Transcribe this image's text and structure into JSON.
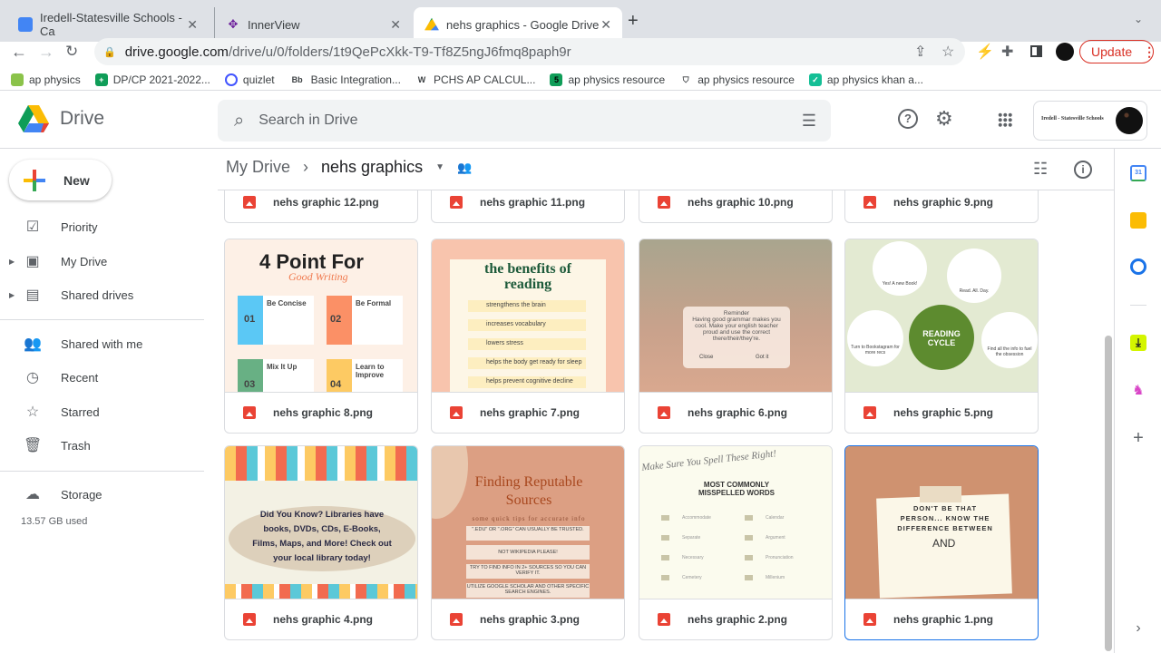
{
  "browser": {
    "tabs": [
      {
        "title": "Iredell-Statesville Schools - Ca",
        "favicon_color": "#4285f4"
      },
      {
        "title": "InnerView",
        "favicon_color": "#6a1b9a"
      },
      {
        "title": "nehs graphics - Google Drive",
        "favicon_color": "#fbbc04"
      }
    ],
    "url_host": "drive.google.com",
    "url_path": "/drive/u/0/folders/1t9QePcXkk-T9-Tf8Z5ngJ6fmq8paph9r",
    "update_label": "Update",
    "bookmarks": [
      "ap physics",
      "DP/CP 2021-2022...",
      "quizlet",
      "Basic Integration...",
      "PCHS AP CALCUL...",
      "ap physics resource",
      "ap physics resource",
      "ap physics khan a..."
    ]
  },
  "drive": {
    "app_name": "Drive",
    "search_placeholder": "Search in Drive",
    "account_org": "Iredell - Statesville Schools",
    "new_label": "New",
    "nav": [
      {
        "label": "Priority",
        "icon": "priority-icon"
      },
      {
        "label": "My Drive",
        "icon": "my-drive-icon"
      },
      {
        "label": "Shared drives",
        "icon": "shared-drives-icon"
      },
      {
        "label": "Shared with me",
        "icon": "shared-with-me-icon"
      },
      {
        "label": "Recent",
        "icon": "clock-icon"
      },
      {
        "label": "Starred",
        "icon": "star-icon"
      },
      {
        "label": "Trash",
        "icon": "trash-icon"
      },
      {
        "label": "Storage",
        "icon": "cloud-icon"
      }
    ],
    "storage_used": "13.57 GB used",
    "breadcrumb": {
      "root": "My Drive",
      "current": "nehs graphics"
    },
    "files": [
      {
        "name": "nehs graphic 12.png"
      },
      {
        "name": "nehs graphic 11.png"
      },
      {
        "name": "nehs graphic 10.png"
      },
      {
        "name": "nehs graphic 9.png"
      },
      {
        "name": "nehs graphic 8.png",
        "thumb": [
          "4 Point For",
          "Good Writing",
          "Be Concise",
          "Be Formal",
          "Mix It Up",
          "Learn to Improve",
          "01",
          "02",
          "03",
          "04"
        ]
      },
      {
        "name": "nehs graphic 7.png",
        "thumb": [
          "the benefits of reading",
          "strengthens the brain",
          "increases vocabulary",
          "lowers stress",
          "helps the body get ready for sleep",
          "helps prevent cognitive decline"
        ]
      },
      {
        "name": "nehs graphic 6.png",
        "thumb": [
          "Reminder",
          "Having good grammar makes you cool. Make your english teacher proud and use the correct there/their/they're.",
          "Close",
          "Got it"
        ]
      },
      {
        "name": "nehs graphic 5.png",
        "thumb": [
          "READING CYCLE",
          "Yes! A new Book!",
          "Read. All. Day.",
          "Turn to Bookstagram for more recs",
          "Find all the info to fuel the obsession"
        ]
      },
      {
        "name": "nehs graphic 4.png",
        "thumb": [
          "Did You Know? Libraries have books, DVDs, CDs, E-Books, Films, Maps, and More! Check out your local library today!"
        ]
      },
      {
        "name": "nehs graphic 3.png",
        "thumb": [
          "Finding Reputable Sources",
          "some quick tips for accurate info",
          "\".EDU\" OR \".ORG\" CAN USUALLY BE TRUSTED.",
          "NOT WIKIPEDIA PLEASE!",
          "TRY TO FIND INFO IN 2+ SOURCES SO YOU CAN VERIFY IT.",
          "UTILIZE GOOGLE SCHOLAR AND OTHER SPECIFIC SEARCH ENGINES."
        ]
      },
      {
        "name": "nehs graphic 2.png",
        "thumb": [
          "Make Sure You Spell These Right!",
          "MOST COMMONLY MISSPELLED WORDS",
          "Accommodate",
          "Calendar",
          "Separate",
          "Argument",
          "Necessary",
          "Pronunciation",
          "Cemetery",
          "Millenium"
        ]
      },
      {
        "name": "nehs graphic 1.png",
        "thumb": [
          "DON'T BE THAT PERSON... KNOW THE DIFFERENCE BETWEEN",
          "AND"
        ]
      }
    ]
  }
}
